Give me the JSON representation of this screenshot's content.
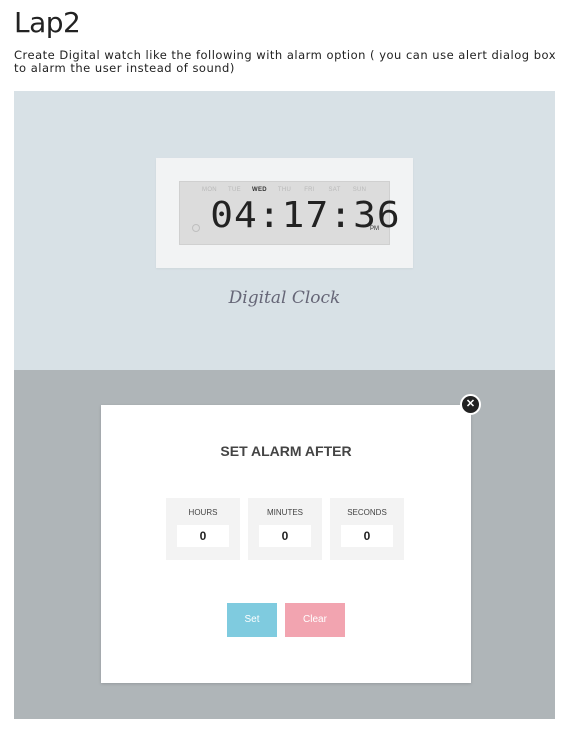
{
  "document": {
    "title": "Lap2",
    "description": "Create Digital watch like the following with alarm option ( you can use alert dialog box to alarm the user instead of sound)"
  },
  "clock": {
    "days": [
      "MON",
      "TUE",
      "WED",
      "THU",
      "FRI",
      "SAT",
      "SUN"
    ],
    "active_day": "WED",
    "time": "04:17:36",
    "ampm": "PM",
    "caption": "Digital Clock",
    "icon": "bell-icon"
  },
  "alarm": {
    "close_icon": "close-icon",
    "title": "SET ALARM AFTER",
    "fields": [
      {
        "label": "HOURS",
        "value": "0"
      },
      {
        "label": "MINUTES",
        "value": "0"
      },
      {
        "label": "SECONDS",
        "value": "0"
      }
    ],
    "set_label": "Set",
    "clear_label": "Clear"
  },
  "colors": {
    "clock_bg": "#d8e1e6",
    "overlay_bg": "#afb5b8",
    "set_button": "#7fcbdf",
    "clear_button": "#f2a4b0"
  }
}
